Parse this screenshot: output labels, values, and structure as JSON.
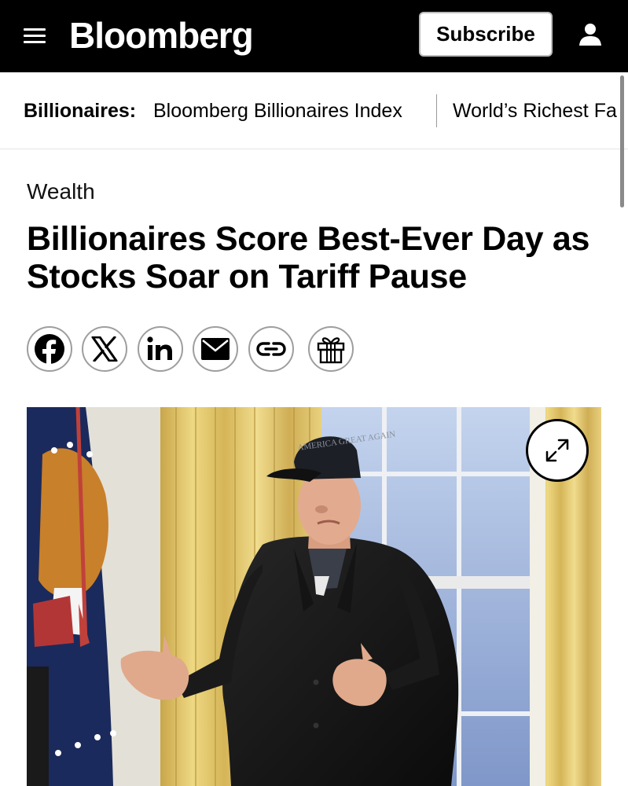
{
  "header": {
    "logo": "Bloomberg",
    "subscribe_label": "Subscribe",
    "menu_icon": "hamburger-menu-icon",
    "account_icon": "user-icon"
  },
  "subnav": {
    "label": "Billionaires:",
    "links": [
      "Bloomberg Billionaires Index",
      "World’s Richest Fa"
    ]
  },
  "article": {
    "category": "Wealth",
    "headline": "Billionaires Score Best-Ever Day as Stocks Soar on Tariff Pause",
    "share_icons": [
      "facebook-icon",
      "x-icon",
      "linkedin-icon",
      "email-icon",
      "link-icon",
      "gift-icon"
    ],
    "hat_text": "AMERICA GREAT AGAIN",
    "expand_icon": "expand-icon"
  }
}
